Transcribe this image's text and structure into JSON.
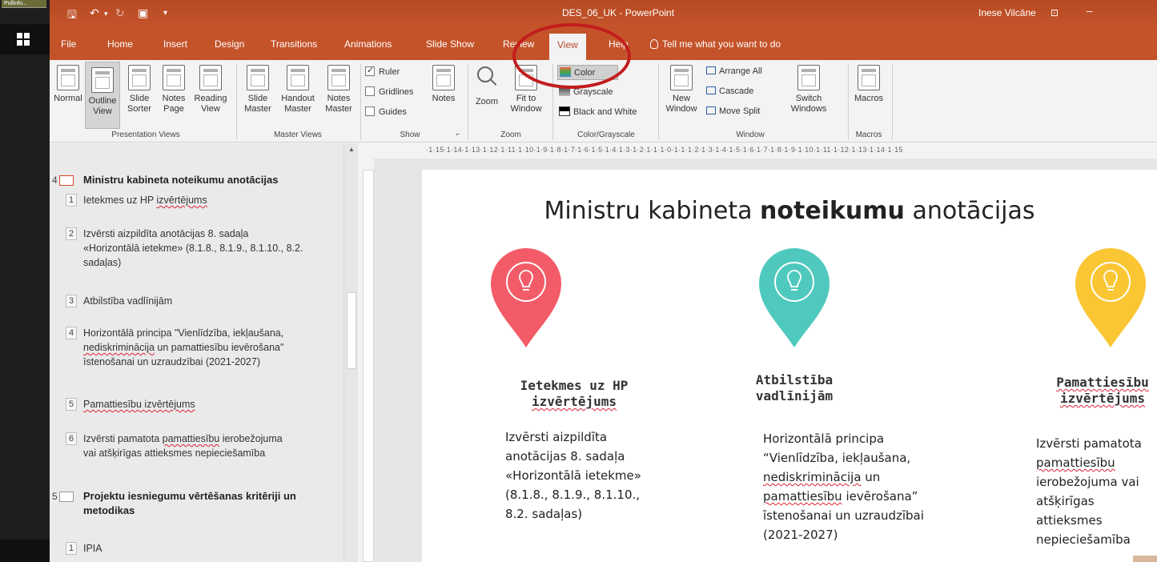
{
  "taskbar": {
    "thumb_label": "Pollinfo..."
  },
  "window": {
    "title": "DES_06_UK - PowerPoint",
    "user": "Inese Vilcāne"
  },
  "tabs": [
    "File",
    "Home",
    "Insert",
    "Design",
    "Transitions",
    "Animations",
    "Slide Show",
    "Review",
    "View",
    "Help"
  ],
  "active_tab": "View",
  "tell_me": "Tell me what you want to do",
  "ribbon": {
    "presentation_views": {
      "label": "Presentation Views",
      "buttons": [
        [
          "Normal",
          ""
        ],
        [
          "Outline",
          "View"
        ],
        [
          "Slide",
          "Sorter"
        ],
        [
          "Notes",
          "Page"
        ],
        [
          "Reading",
          "View"
        ]
      ]
    },
    "master_views": {
      "label": "Master Views",
      "buttons": [
        [
          "Slide",
          "Master"
        ],
        [
          "Handout",
          "Master"
        ],
        [
          "Notes",
          "Master"
        ]
      ]
    },
    "show": {
      "label": "Show",
      "ruler": "Ruler",
      "gridlines": "Gridlines",
      "guides": "Guides",
      "notes": "Notes"
    },
    "zoom": {
      "label": "Zoom",
      "zoom": "Zoom",
      "fit1": "Fit to",
      "fit2": "Window"
    },
    "color": {
      "label": "Color/Grayscale",
      "color": "Color",
      "grayscale": "Grayscale",
      "bw": "Black and White"
    },
    "window": {
      "label": "Window",
      "new1": "New",
      "new2": "Window",
      "arrange": "Arrange All",
      "cascade": "Cascade",
      "move_split": "Move Split",
      "switch1": "Switch",
      "switch2": "Windows"
    },
    "macros": {
      "label": "Macros",
      "macros": "Macros"
    }
  },
  "outline": {
    "slide4": {
      "num": "4",
      "title": "Ministru kabineta noteikumu anotācijas",
      "items": [
        {
          "n": "1",
          "pre": "Ietekmes uz HP ",
          "wavy": "izvērtējums"
        },
        {
          "n": "2",
          "lines": [
            "Izvērsti aizpildīta anotācijas 8. sadaļa",
            "«Horizontālā ietekme» (8.1.8., 8.1.9., 8.1.10., 8.2.",
            "sadaļas)"
          ]
        },
        {
          "n": "3",
          "lines": [
            "Atbilstība vadlīnijām"
          ]
        },
        {
          "n": "4",
          "l1": "Horizontālā principa \"Vienlīdzība, iekļaušana,",
          "l2_wavy": "nediskriminācija",
          "l2_rest": " un pamattiesību ievērošana\"",
          "l3": "īstenošanai un uzraudzībai (2021-2027)"
        },
        {
          "n": "5",
          "wavy": "Pamattiesību izvērtējums"
        },
        {
          "n": "6",
          "l1_pre": "Izvērsti pamatota ",
          "l1_wavy": "pamattiesību",
          "l1_post": " ierobežojuma",
          "l2": "vai atšķirīgas attieksmes nepieciešamība"
        }
      ]
    },
    "slide5": {
      "num": "5",
      "title_l1": "Projektu iesniegumu vērtēšanas kritēriji un",
      "title_l2": "metodikas",
      "items": [
        {
          "n": "1",
          "text": "IPIA"
        }
      ]
    }
  },
  "ruler_text": "·1·15·1·14·1·13·1·12·1·11·1·10·1·9·1·8·1·7·1·6·1·5·1·4·1·3·1·2·1·1·1·0·1·1·1·2·1·3·1·4·1·5·1·6·1·7·1·8·1·9·1·10·1·11·1·12·1·13·1·14·1·15",
  "slide": {
    "title_pre": "Ministru kabineta ",
    "title_bold": "noteikumu",
    "title_post": " anotācijas",
    "col1": {
      "label_l1": "Ietekmes uz HP",
      "label_l2": "izvērtējums",
      "desc": [
        "Izvērsti aizpildīta",
        "anotācijas 8. sadaļa",
        "«Horizontālā ietekme»",
        "(8.1.8., 8.1.9., 8.1.10.,",
        "8.2. sadaļas)"
      ],
      "color": "#f35b69"
    },
    "col2": {
      "label_l1": "Atbilstība",
      "label_l2": "vadlīnijām",
      "d1": "Horizontālā principa",
      "d2": "“Vienlīdzība, iekļaušana,",
      "d3_wavy": "nediskriminācija",
      "d3_post": " un",
      "d4_wavy": "pamattiesību",
      "d4_post": " ievērošana”",
      "d5": "īstenošanai un uzraudzībai",
      "d6": "(2021-2027)",
      "color": "#4fc9bd"
    },
    "col3": {
      "label_l1": "Pamattiesību",
      "label_l2": "izvērtējums",
      "d1": "Izvērsti pamatota",
      "d2_wavy": "pamattiesību",
      "d3": "ierobežojuma vai",
      "d4": "atšķirīgas attieksmes",
      "d5": "nepieciešamība",
      "color": "#fbc634"
    }
  }
}
